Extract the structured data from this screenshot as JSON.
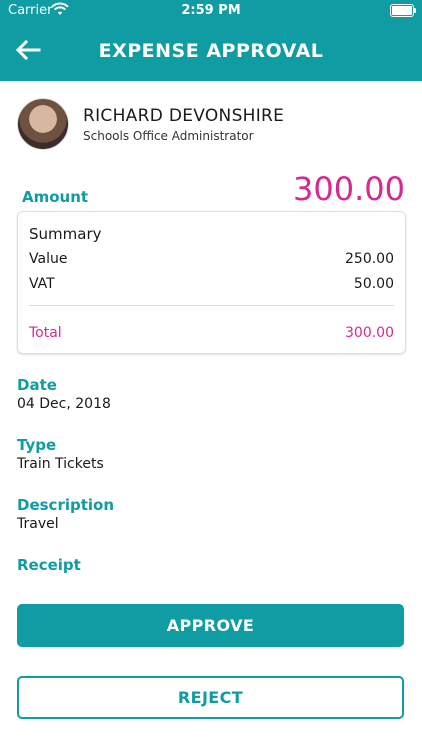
{
  "status_bar": {
    "carrier": "Carrier",
    "time": "2:59 PM"
  },
  "header": {
    "title": "EXPENSE APPROVAL",
    "back_icon": "back-arrow-icon"
  },
  "profile": {
    "name": "RICHARD DEVONSHIRE",
    "role": "Schools Office Administrator"
  },
  "amount": {
    "label": "Amount",
    "value": "300.00"
  },
  "summary": {
    "title": "Summary",
    "rows": [
      {
        "label": "Value",
        "value": "250.00"
      },
      {
        "label": "VAT",
        "value": "50.00"
      }
    ],
    "total_label": "Total",
    "total_value": "300.00"
  },
  "details": {
    "date_label": "Date",
    "date_value": "04 Dec, 2018",
    "type_label": "Type",
    "type_value": "Train Tickets",
    "description_label": "Description",
    "description_value": "Travel",
    "receipt_label": "Receipt"
  },
  "actions": {
    "approve": "APPROVE",
    "reject": "REJECT"
  },
  "colors": {
    "accent": "#0f9ca3",
    "highlight": "#d52a8e"
  }
}
